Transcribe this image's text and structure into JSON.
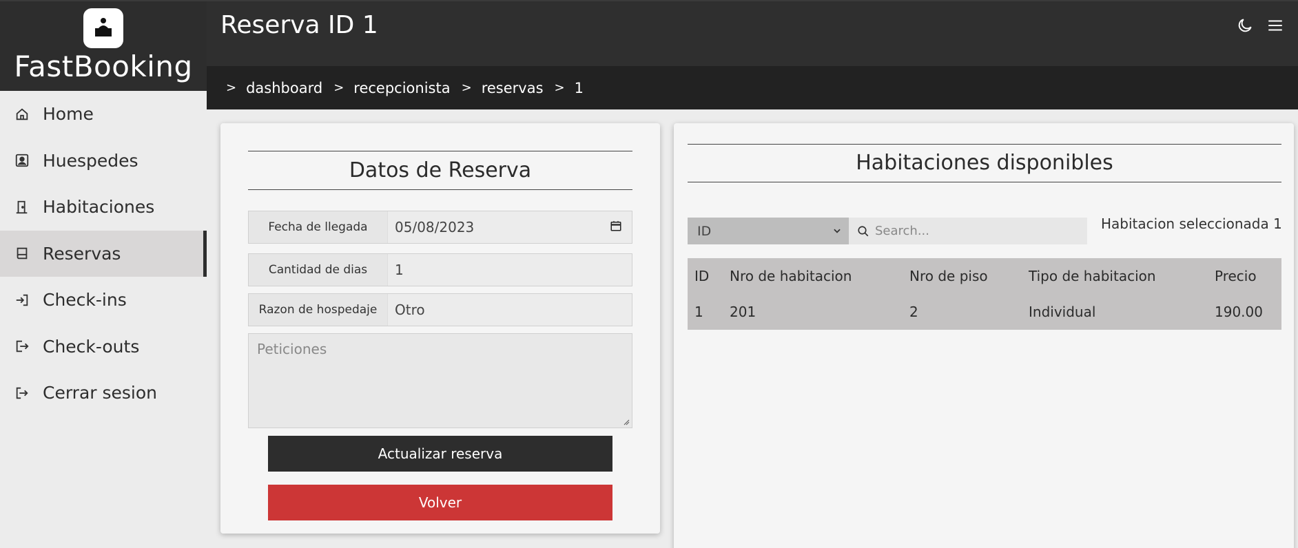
{
  "app": {
    "brand": "FastBooking"
  },
  "sidebar": {
    "items": [
      {
        "label": "Home",
        "icon": "home-icon"
      },
      {
        "label": "Huespedes",
        "icon": "guest-icon"
      },
      {
        "label": "Habitaciones",
        "icon": "door-icon"
      },
      {
        "label": "Reservas",
        "icon": "book-icon"
      },
      {
        "label": "Check-ins",
        "icon": "login-icon"
      },
      {
        "label": "Check-outs",
        "icon": "logout-icon"
      },
      {
        "label": "Cerrar sesion",
        "icon": "exit-icon"
      }
    ],
    "active": "Reservas"
  },
  "header": {
    "title": "Reserva ID 1"
  },
  "breadcrumb": {
    "items": [
      "dashboard",
      "recepcionista",
      "reservas",
      "1"
    ]
  },
  "reserva": {
    "title": "Datos de Reserva",
    "fecha_label": "Fecha de llegada",
    "fecha_value": "05/08/2023",
    "dias_label": "Cantidad de dias",
    "dias_value": "1",
    "razon_label": "Razon de hospedaje",
    "razon_value": "Otro",
    "peticiones_placeholder": "Peticiones",
    "update_label": "Actualizar reserva",
    "back_label": "Volver"
  },
  "habitaciones": {
    "title": "Habitaciones disponibles",
    "filter_selected": "ID",
    "search_placeholder": "Search...",
    "selected_text": "Habitacion seleccionada 1",
    "columns": [
      "ID",
      "Nro de habitacion",
      "Nro de piso",
      "Tipo de habitacion",
      "Precio"
    ],
    "rows": [
      [
        "1",
        "201",
        "2",
        "Individual",
        "190.00"
      ]
    ]
  },
  "colors": {
    "dark": "#2d2d2d",
    "danger": "#cc3636",
    "active_nav": "#d9d7d7"
  }
}
